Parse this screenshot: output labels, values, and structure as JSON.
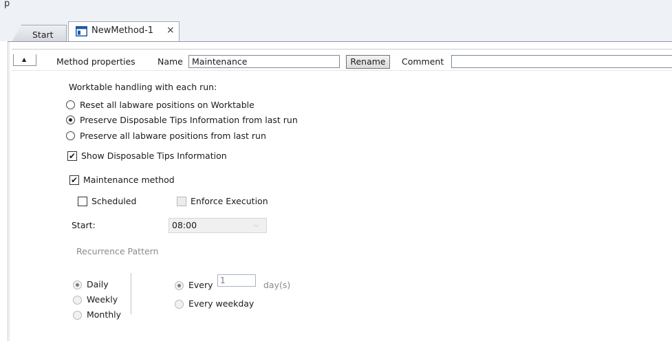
{
  "window": {
    "corner_letter": "p"
  },
  "tabs": [
    {
      "label": "Start",
      "active": false
    },
    {
      "label": "NewMethod-1",
      "active": true,
      "close": "×"
    }
  ],
  "method_header": {
    "collapse_glyph": "▲",
    "section_label": "Method properties",
    "name_label": "Name",
    "name_value": "Maintenance",
    "rename_label": "Rename",
    "comment_label": "Comment",
    "comment_value": ""
  },
  "worktable": {
    "heading": "Worktable handling with each run:",
    "options": [
      {
        "label": "Reset all labware positions on Worktable",
        "selected": false
      },
      {
        "label": "Preserve Disposable Tips Information from last run",
        "selected": true
      },
      {
        "label": "Preserve all labware positions from last run",
        "selected": false
      }
    ],
    "show_tips_label": "Show Disposable Tips Information",
    "show_tips_checked": true
  },
  "maintenance": {
    "label": "Maintenance method",
    "checked": true,
    "scheduled_label": "Scheduled",
    "scheduled_checked": false,
    "enforce_label": "Enforce Execution",
    "enforce_checked": false,
    "start_label": "Start:",
    "start_value": "08:00",
    "recurrence_label": "Recurrence Pattern",
    "pattern_options": [
      {
        "label": "Daily",
        "selected": true
      },
      {
        "label": "Weekly",
        "selected": false
      },
      {
        "label": "Monthly",
        "selected": false
      }
    ],
    "every_label": "Every",
    "every_value": "1",
    "every_unit": "day(s)",
    "every_selected": true,
    "every_weekday_label": "Every weekday",
    "every_weekday_selected": false
  },
  "colors": {
    "tab_icon": "#1e5aa8",
    "topbar_bg": "#eef1f6"
  }
}
